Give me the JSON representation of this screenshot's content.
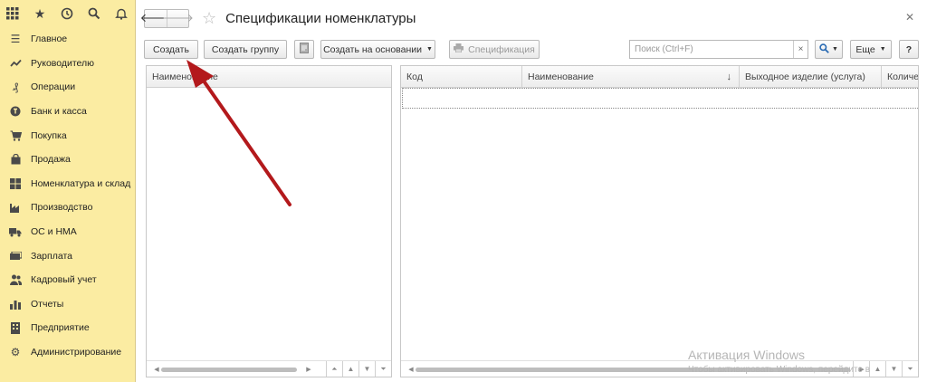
{
  "sidebar": {
    "top_icons": [
      "apps-grid-icon",
      "star-icon",
      "history-icon",
      "search-icon",
      "bell-icon"
    ],
    "items": [
      {
        "label": "Главное",
        "icon": "menu-lines-icon"
      },
      {
        "label": "Руководителю",
        "icon": "trend-chart-icon"
      },
      {
        "label": "Операции",
        "icon": "operations-icon"
      },
      {
        "label": "Банк и касса",
        "icon": "coin-icon"
      },
      {
        "label": "Покупка",
        "icon": "cart-icon"
      },
      {
        "label": "Продажа",
        "icon": "bag-icon"
      },
      {
        "label": "Номенклатура и склад",
        "icon": "warehouse-icon"
      },
      {
        "label": "Производство",
        "icon": "factory-icon"
      },
      {
        "label": "ОС и НМА",
        "icon": "truck-icon"
      },
      {
        "label": "Зарплата",
        "icon": "money-icon"
      },
      {
        "label": "Кадровый учет",
        "icon": "people-icon"
      },
      {
        "label": "Отчеты",
        "icon": "bar-chart-icon"
      },
      {
        "label": "Предприятие",
        "icon": "building-icon"
      },
      {
        "label": "Администрирование",
        "icon": "gear-icon"
      }
    ]
  },
  "header": {
    "title": "Спецификации номенклатуры"
  },
  "toolbar": {
    "create": "Создать",
    "create_group": "Создать группу",
    "create_based_on": "Создать на основании",
    "specification": "Спецификация",
    "search_placeholder": "Поиск (Ctrl+F)",
    "search_clear": "×",
    "more": "Еще",
    "help": "?"
  },
  "left_table": {
    "columns": [
      "Наименование"
    ]
  },
  "right_table": {
    "columns": [
      "Код",
      "Наименование",
      "Выходное изделие (услуга)",
      "Количе"
    ]
  },
  "watermark": {
    "title": "Активация Windows",
    "subtitle": "Чтобы активировать Windows, перейдите в"
  },
  "colors": {
    "sidebar_bg": "#fbeca2",
    "annotation_arrow": "#b3191c"
  }
}
